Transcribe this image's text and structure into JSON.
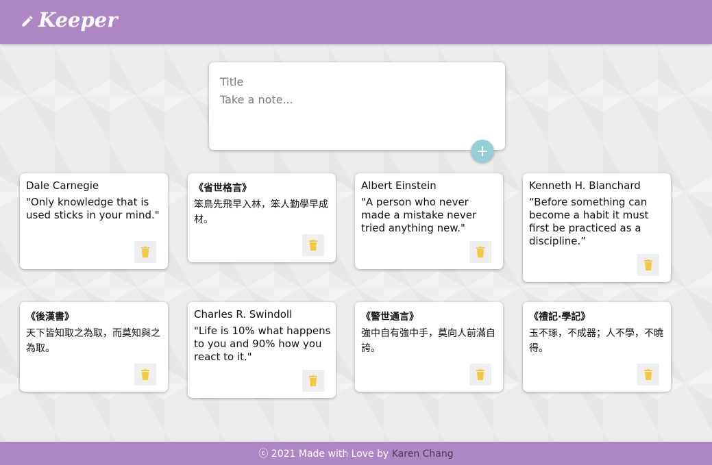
{
  "header": {
    "app_name": "Keeper",
    "icon": "pencil-icon"
  },
  "compose": {
    "title_placeholder": "Title",
    "content_placeholder": "Take a note...",
    "add_icon": "plus-icon"
  },
  "notes": [
    {
      "title": "Dale Carnegie",
      "content": "\"Only knowledge that is used sticks in your mind.\""
    },
    {
      "title": "《省世格言》",
      "content": "笨鳥先飛早入林，笨人勤學早成材。"
    },
    {
      "title": "Albert Einstein",
      "content": "\"A person who never made a mistake never tried anything new.\""
    },
    {
      "title": "Kenneth H. Blanchard",
      "content": "“Before something can become a habit it must first be practiced as a discipline.”"
    },
    {
      "title": "《後漢書》",
      "content": "天下皆知取之為取，而莫知與之為取。"
    },
    {
      "title": "Charles R. Swindoll",
      "content": "\"Life is 10% what happens to you and 90% how you react to it.\""
    },
    {
      "title": "《警世通言》",
      "content": "強中自有強中手，莫向人前滿自誇。"
    },
    {
      "title": "《禮記·學記》",
      "content": "玉不琢，不成器；人不學，不曉得。"
    }
  ],
  "footer": {
    "text": "ⓒ 2021 Made with Love by",
    "author": "Karen Chang"
  },
  "colors": {
    "primary": "#ae87c4",
    "accent": "#94cfd8",
    "trash_icon": "#f5c842",
    "author_link": "#4e3c5a"
  }
}
